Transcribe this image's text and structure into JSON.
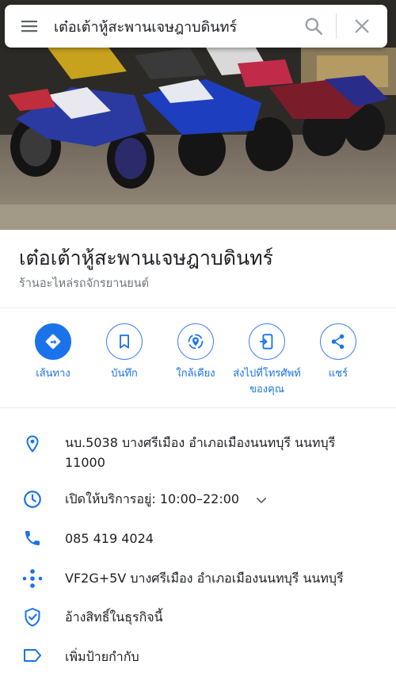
{
  "search": {
    "query": "เต๋อเต้าหู้สะพานเจษฎาบดินทร์",
    "menu_icon": "hamburger-menu-icon",
    "search_icon": "search-icon",
    "close_icon": "close-icon"
  },
  "hero": {
    "description_icon": "place-photo"
  },
  "place": {
    "name": "เต๋อเต้าหู้สะพานเจษฎาบดินทร์",
    "category": "ร้านอะไหล่รถจักรยานยนต์"
  },
  "actions": [
    {
      "label": "เส้นทาง",
      "icon": "directions-icon"
    },
    {
      "label": "บันทึก",
      "icon": "bookmark-icon"
    },
    {
      "label": "ใกล้เคียง",
      "icon": "nearby-icon"
    },
    {
      "label": "ส่งไปที่โทรศัพท์ ของคุณ",
      "icon": "send-to-phone-icon"
    },
    {
      "label": "แชร์",
      "icon": "share-icon"
    }
  ],
  "info": {
    "address_line1": "นบ.5038 บางศรีเมือง อำเภอเมืองนนทบุรี นนทบุรี",
    "address_line2": "11000",
    "hours": "เปิดให้บริการอยู่:  10:00–22:00",
    "phone": "085 419 4024",
    "plus_code": "VF2G+5V บางศรีเมือง อำเภอเมืองนนทบุรี นนทบุรี",
    "claim": "อ้างสิทธิ์ในธุรกิจนี้",
    "add_label": "เพิ่มป้ายกำกับ"
  },
  "colors": {
    "accent": "#1a73e8",
    "text_primary": "#202124",
    "text_secondary": "#70757a",
    "divider": "#e8eaed"
  }
}
